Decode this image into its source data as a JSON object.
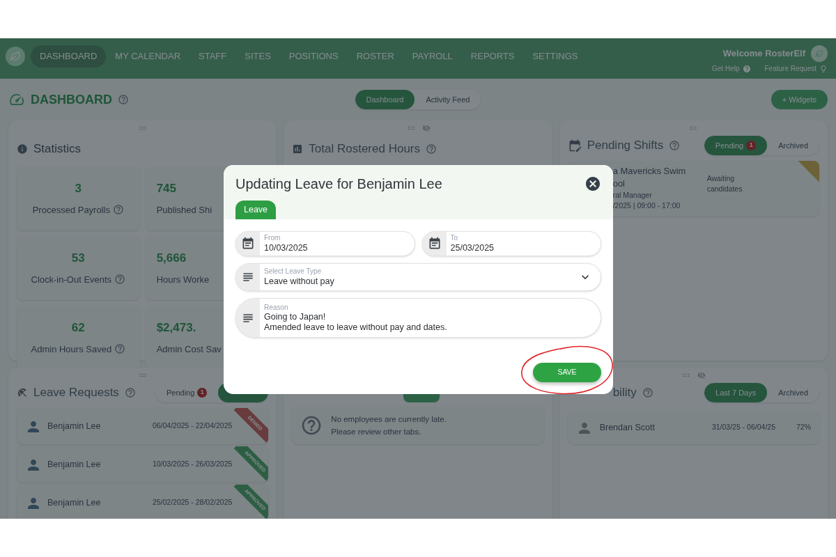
{
  "nav": {
    "items": [
      {
        "label": "DASHBOARD",
        "selected": true
      },
      {
        "label": "MY CALENDAR",
        "selected": false
      },
      {
        "label": "STAFF",
        "selected": false
      },
      {
        "label": "SITES",
        "selected": false
      },
      {
        "label": "POSITIONS",
        "selected": false
      },
      {
        "label": "ROSTER",
        "selected": false
      },
      {
        "label": "PAYROLL",
        "selected": false
      },
      {
        "label": "REPORTS",
        "selected": false
      },
      {
        "label": "SETTINGS",
        "selected": false
      }
    ],
    "welcome": "Welcome RosterElf",
    "get_help": "Get Help",
    "feature_request": "Feature Request"
  },
  "page_header": {
    "title": "DASHBOARD",
    "view_tabs": [
      {
        "label": "Dashboard",
        "selected": true
      },
      {
        "label": "Activity Feed",
        "selected": false
      }
    ],
    "add_button": "+ Widgets"
  },
  "statistics": {
    "title": "Statistics",
    "stats": [
      {
        "value": "3",
        "label": "Processed Payrolls",
        "help": true
      },
      {
        "value": "745",
        "label": "Published Shi"
      },
      {
        "value": "53",
        "label": "Clock-in-Out Events",
        "help": true
      },
      {
        "value": "5,666",
        "label": "Hours Worke"
      },
      {
        "value": "62",
        "label": "Admin Hours Saved",
        "help": true
      },
      {
        "value": "$2,473.",
        "label": "Admin Cost Sav"
      }
    ]
  },
  "total_rostered_hours": {
    "title": "Total Rostered Hours"
  },
  "pending_shifts": {
    "title": "Pending Shifts",
    "tabs": [
      {
        "label": "Pending",
        "badge": "1",
        "selected": true
      },
      {
        "label": "Archived",
        "selected": false
      }
    ],
    "shift": {
      "lines": [
        "a Mavericks Swim",
        "ool",
        "ral Manager",
        "/2025 | 09:00 - 17:00"
      ],
      "status": "Awaiting candidates"
    }
  },
  "leave_requests": {
    "title": "Leave Requests",
    "tabs": [
      {
        "label": "Pending",
        "badge": "1",
        "selected": false
      },
      {
        "selected": true
      }
    ],
    "rows": [
      {
        "name": "Benjamin Lee",
        "dates": "06/04/2025 - 22/04/2025",
        "status": "DENIED",
        "kind": "denied"
      },
      {
        "name": "Benjamin Lee",
        "dates": "10/03/2025 - 26/03/2025",
        "status": "APPROVED",
        "kind": "approved"
      },
      {
        "name": "Benjamin Lee",
        "dates": "25/02/2025 - 28/02/2025",
        "status": "APPROVED",
        "kind": "approved"
      }
    ]
  },
  "lateness": {
    "message": [
      "No employees are currently late.",
      "Please review other tabs."
    ]
  },
  "availability": {
    "title": "bility",
    "tabs": [
      {
        "label": "Last 7 Days",
        "selected": true
      },
      {
        "label": "Archived",
        "selected": false
      }
    ],
    "rows": [
      {
        "name": "Brendan Scott",
        "dates": "31/03/25 - 06/04/25",
        "percent": "72%"
      }
    ]
  },
  "modal": {
    "title": "Updating Leave for Benjamin Lee",
    "tabs": [
      {
        "label": "Leave",
        "selected": true
      }
    ],
    "fields": [
      {
        "kind": "date",
        "label": "From",
        "value": "10/03/2025"
      },
      {
        "kind": "date",
        "label": "To",
        "value": "25/03/2025"
      },
      {
        "kind": "select",
        "label": "Select Leave Type",
        "value": "Leave without pay"
      },
      {
        "kind": "textarea",
        "label": "Reason",
        "lines": [
          "Going to Japan!",
          "Amended leave to leave without pay and dates."
        ]
      }
    ],
    "save": "SAVE"
  }
}
